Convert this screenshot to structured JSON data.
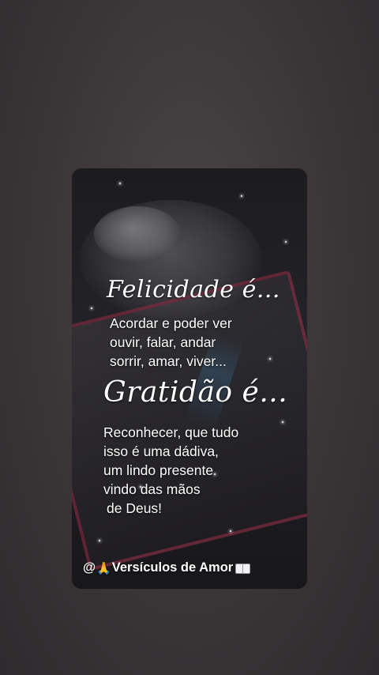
{
  "card": {
    "heading1": "Felicidade é...",
    "lines1": [
      "Acordar e poder ver",
      "ouvir, falar, andar",
      "sorrir, amar, viver..."
    ],
    "heading2": "Gratidão é...",
    "lines2": [
      "Reconhecer, que tudo",
      "isso é uma dádiva,",
      "um lindo presente",
      "vindo das mãos",
      "de Deus!"
    ],
    "handle_prefix": "@",
    "handle_name": "Versículos de Amor",
    "handle_icons": [
      "praying-hands-icon",
      "open-book-icon"
    ]
  },
  "colors": {
    "background": "#3a3638",
    "card": "#1e1d21",
    "text": "#ffffff"
  }
}
